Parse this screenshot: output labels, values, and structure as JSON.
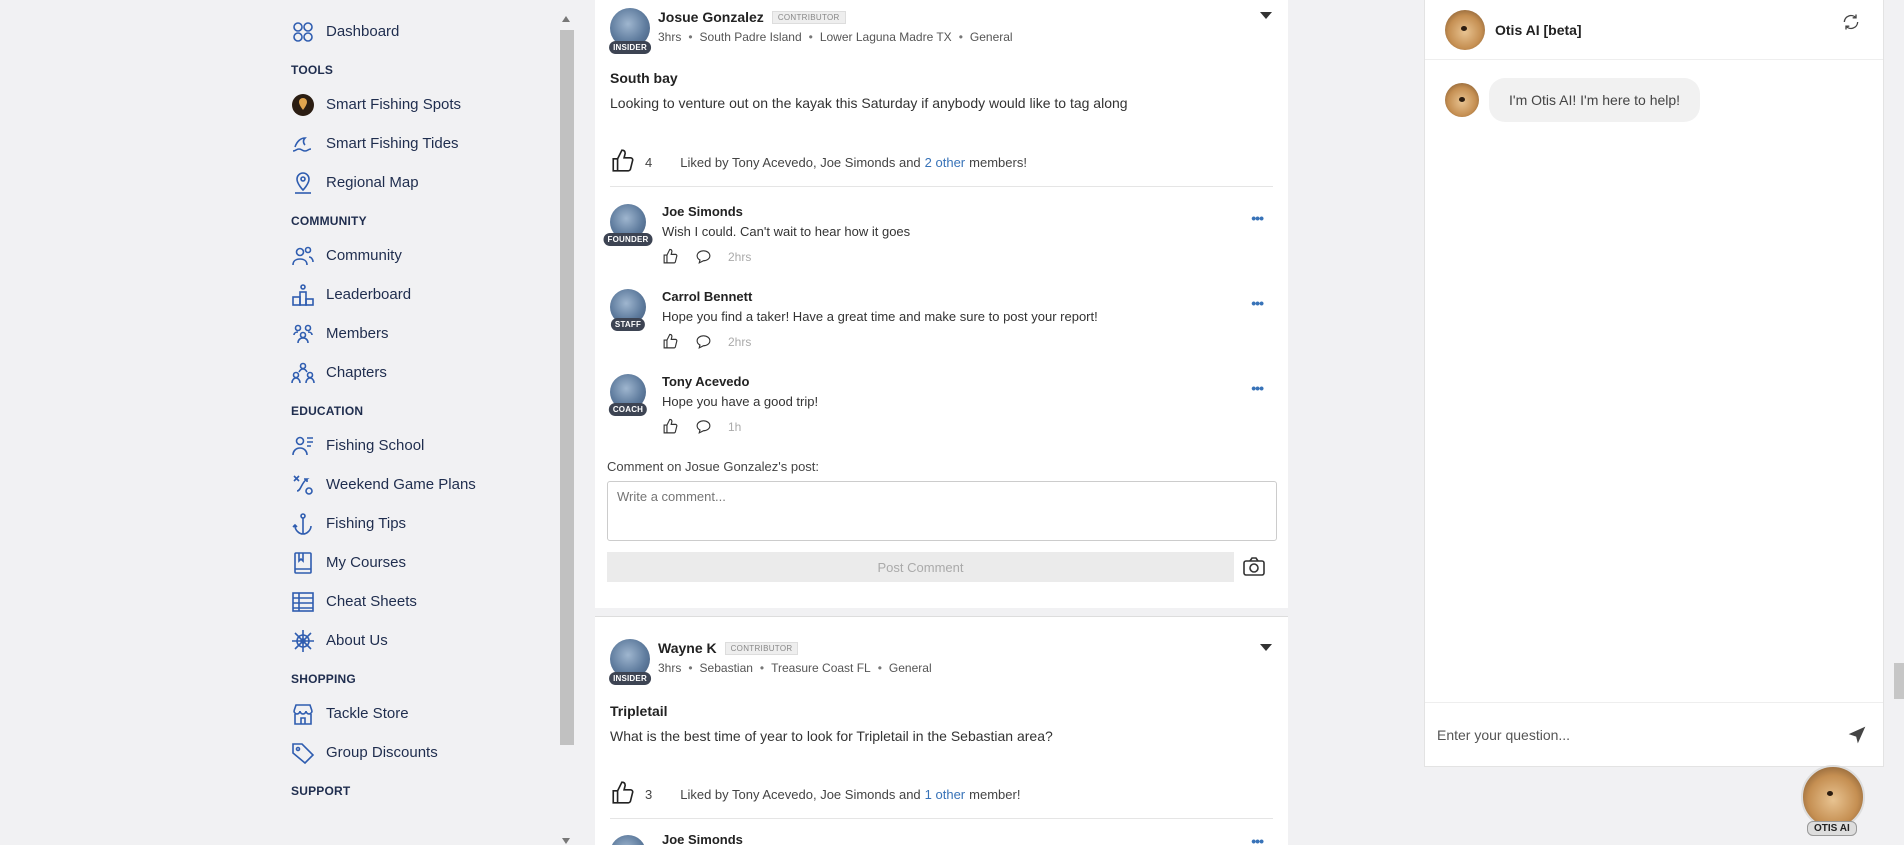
{
  "sidebar": {
    "top_item": {
      "label": "Dashboard",
      "icon": "dashboard-icon"
    },
    "sections": [
      {
        "title": "TOOLS",
        "items": [
          {
            "label": "Smart Fishing Spots",
            "icon": "location-pin-icon"
          },
          {
            "label": "Smart Fishing Tides",
            "icon": "waves-icon"
          },
          {
            "label": "Regional Map",
            "icon": "map-pin-icon"
          }
        ]
      },
      {
        "title": "COMMUNITY",
        "items": [
          {
            "label": "Community",
            "icon": "people-icon"
          },
          {
            "label": "Leaderboard",
            "icon": "podium-icon"
          },
          {
            "label": "Members",
            "icon": "members-icon"
          },
          {
            "label": "Chapters",
            "icon": "chapters-icon"
          }
        ]
      },
      {
        "title": "EDUCATION",
        "items": [
          {
            "label": "Fishing School",
            "icon": "school-icon"
          },
          {
            "label": "Weekend Game Plans",
            "icon": "game-plan-icon"
          },
          {
            "label": "Fishing Tips",
            "icon": "anchor-icon"
          },
          {
            "label": "My Courses",
            "icon": "book-icon"
          },
          {
            "label": "Cheat Sheets",
            "icon": "table-icon"
          },
          {
            "label": "About Us",
            "icon": "helm-icon"
          }
        ]
      },
      {
        "title": "SHOPPING",
        "items": [
          {
            "label": "Tackle Store",
            "icon": "store-icon"
          },
          {
            "label": "Group Discounts",
            "icon": "tag-icon"
          }
        ]
      },
      {
        "title": "SUPPORT",
        "items": []
      }
    ]
  },
  "posts": [
    {
      "author": "Josue Gonzalez",
      "role": "CONTRIBUTOR",
      "badge": "INSIDER",
      "time": "3hrs",
      "location": "South Padre Island",
      "region": "Lower Laguna Madre TX",
      "category": "General",
      "title": "South bay",
      "body": "Looking to venture out on the kayak this Saturday if anybody would like to tag along",
      "likes": "4",
      "liked_by_prefix": "Liked by Tony Acevedo, Joe Simonds and",
      "liked_by_link": "2 other",
      "liked_by_suffix": "members!",
      "comments": [
        {
          "name": "Joe Simonds",
          "badge": "FOUNDER",
          "text": "Wish I could. Can't wait to hear how it goes",
          "time": "2hrs"
        },
        {
          "name": "Carrol Bennett",
          "badge": "STAFF",
          "text": "Hope you find a taker! Have a great time and make sure to post your report!",
          "time": "2hrs"
        },
        {
          "name": "Tony Acevedo",
          "badge": "COACH",
          "text": "Hope you have a good trip!",
          "time": "1h"
        }
      ],
      "comment_label": "Comment on Josue Gonzalez's post:",
      "comment_placeholder": "Write a comment...",
      "post_button": "Post Comment"
    },
    {
      "author": "Wayne K",
      "role": "CONTRIBUTOR",
      "badge": "INSIDER",
      "time": "3hrs",
      "location": "Sebastian",
      "region": "Treasure Coast FL",
      "category": "General",
      "title": "Tripletail",
      "body": "What is the best time of year to look for Tripletail in the Sebastian area?",
      "likes": "3",
      "liked_by_prefix": "Liked by Tony Acevedo, Joe Simonds and",
      "liked_by_link": "1 other",
      "liked_by_suffix": "member!",
      "next_comment_name": "Joe Simonds"
    }
  ],
  "chat": {
    "title": "Otis AI [beta]",
    "greeting": "I'm Otis AI! I'm here to help!",
    "input_placeholder": "Enter your question...",
    "fab_label": "OTIS AI"
  },
  "colors": {
    "nav_text": "#1f2d4e",
    "link": "#3873b8",
    "badge_bg": "#3d4453"
  }
}
